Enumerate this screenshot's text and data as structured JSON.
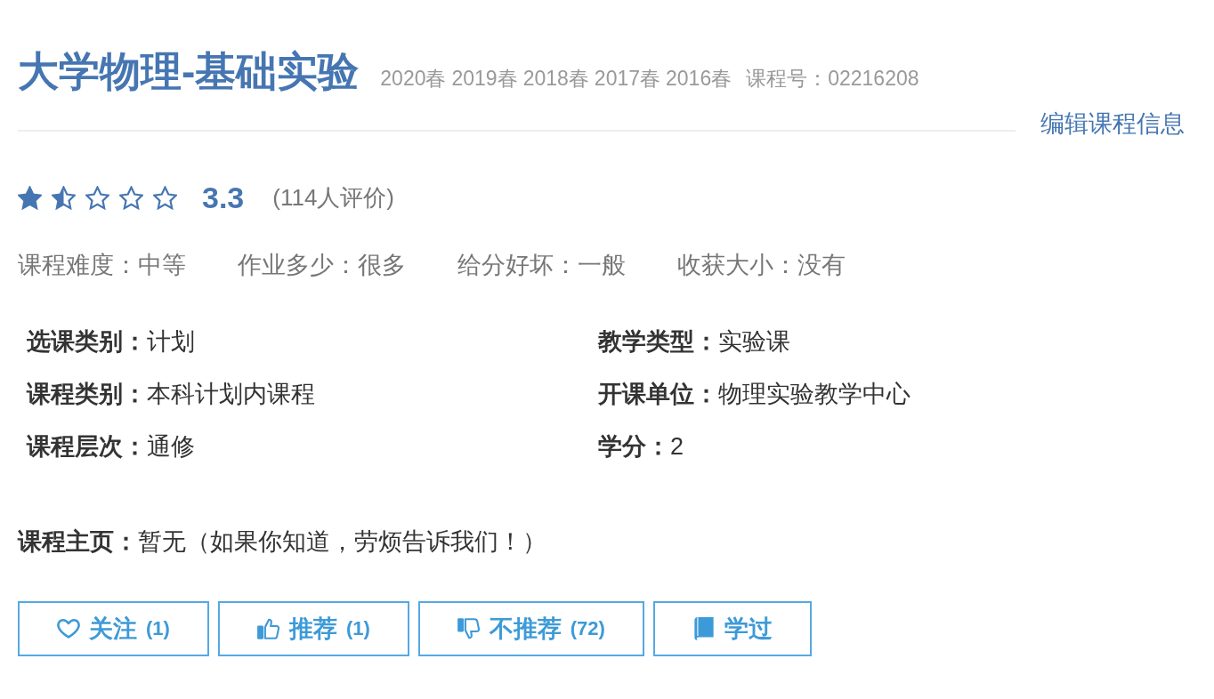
{
  "course": {
    "title": "大学物理-基础实验",
    "semesters": [
      "2020春",
      "2019春",
      "2018春",
      "2017春",
      "2016春"
    ],
    "course_number": "课程号：02216208"
  },
  "edit_link": "编辑课程信息",
  "rating": {
    "stars": 1.5,
    "score": "3.3",
    "count": "(114人评价)"
  },
  "aspects": [
    "课程难度：中等",
    "作业多少：很多",
    "给分好坏：一般",
    "收获大小：没有"
  ],
  "details": [
    {
      "label": "选课类别：",
      "value": "计划"
    },
    {
      "label": "教学类型：",
      "value": "实验课"
    },
    {
      "label": "课程类别：",
      "value": "本科计划内课程"
    },
    {
      "label": "开课单位：",
      "value": "物理实验教学中心"
    },
    {
      "label": "课程层次：",
      "value": "通修"
    },
    {
      "label": "学分：",
      "value": "2"
    }
  ],
  "homepage": {
    "label": "课程主页：",
    "value": "暂无（如果你知道，劳烦告诉我们！）"
  },
  "actions": [
    {
      "kind": "follow",
      "label": "关注",
      "count": "(1)"
    },
    {
      "kind": "recommend",
      "label": "推荐",
      "count": "(1)"
    },
    {
      "kind": "not-recommend",
      "label": "不推荐",
      "count": "(72)"
    },
    {
      "kind": "studied",
      "label": "学过"
    }
  ]
}
